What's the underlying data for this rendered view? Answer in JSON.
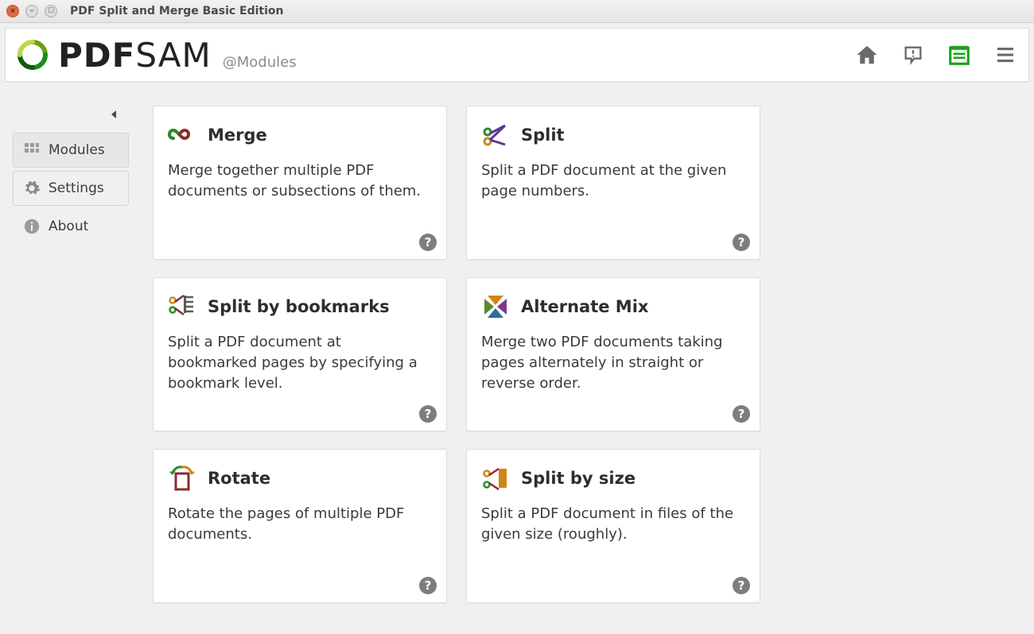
{
  "window": {
    "title": "PDF Split and Merge Basic Edition"
  },
  "header": {
    "logo_main": "PDF",
    "logo_sub": "SAM",
    "breadcrumb": "@Modules"
  },
  "sidebar": {
    "items": [
      {
        "label": "Modules"
      },
      {
        "label": "Settings"
      },
      {
        "label": "About"
      }
    ]
  },
  "modules": [
    {
      "title": "Merge",
      "desc": "Merge together multiple PDF documents or subsections of them."
    },
    {
      "title": "Split",
      "desc": "Split a PDF document at the given page numbers."
    },
    {
      "title": "Split by bookmarks",
      "desc": "Split a PDF document at bookmarked pages by specifying a bookmark level."
    },
    {
      "title": "Alternate Mix",
      "desc": "Merge two PDF documents taking pages alternately in straight or reverse order."
    },
    {
      "title": "Rotate",
      "desc": "Rotate the pages of multiple PDF documents."
    },
    {
      "title": "Split by size",
      "desc": "Split a PDF document in files of the given size (roughly)."
    }
  ]
}
